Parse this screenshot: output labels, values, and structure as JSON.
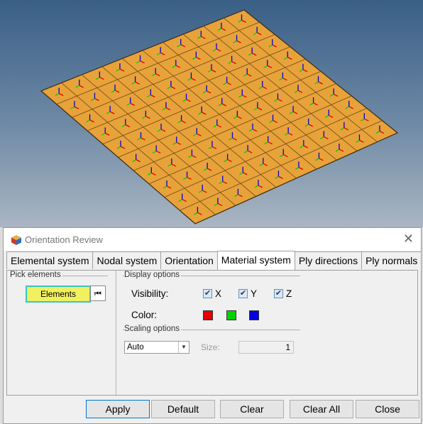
{
  "dialog": {
    "title": "Orientation Review",
    "tabs": [
      {
        "label": "Elemental system"
      },
      {
        "label": "Nodal system"
      },
      {
        "label": "Orientation"
      },
      {
        "label": "Material system",
        "active": true
      },
      {
        "label": "Ply directions"
      },
      {
        "label": "Ply normals"
      }
    ],
    "pick": {
      "group_label": "Pick elements",
      "elements_button": "Elements",
      "reset_glyph": "⏮"
    },
    "display": {
      "group_label": "Display options",
      "visibility_label": "Visibility:",
      "x": {
        "label": "X",
        "checked": true
      },
      "y": {
        "label": "Y",
        "checked": true
      },
      "z": {
        "label": "Z",
        "checked": true
      },
      "color_label": "Color:",
      "colors": {
        "x": "#e00000",
        "y": "#00d000",
        "z": "#0000e0"
      }
    },
    "scaling": {
      "group_label": "Scaling options",
      "mode": "Auto",
      "size_label": "Size:",
      "size_value": "1"
    },
    "buttons": {
      "apply": "Apply",
      "default": "Default",
      "clear": "Clear",
      "clear_all": "Clear All",
      "close": "Close"
    }
  },
  "viewport": {
    "background_top": "#3a5f86",
    "plate_color": "#e8a23a",
    "mesh_divisions": 10
  }
}
